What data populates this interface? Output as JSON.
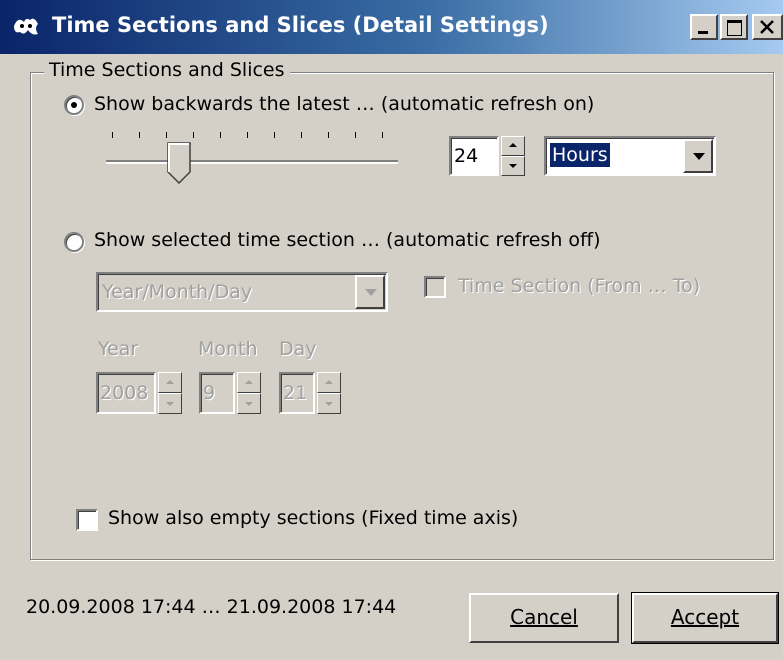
{
  "window": {
    "title": "Time Sections and Slices (Detail Settings)",
    "controls": {
      "minimize": "_",
      "maximize": "□",
      "close": "X"
    }
  },
  "group": {
    "label": "Time Sections and Slices"
  },
  "latest": {
    "radio_label": "Show backwards the latest … (automatic refresh on)",
    "selected": true,
    "slider_position": 0.25,
    "amount": "24",
    "unit": "Hours"
  },
  "section": {
    "radio_label": "Show selected time section … (automatic refresh off)",
    "selected": false,
    "mode_value": "Year/Month/Day",
    "time_section_label": "Time Section (From … To)",
    "year_label": "Year",
    "month_label": "Month",
    "day_label": "Day",
    "year": "2008",
    "month": "9",
    "day": "21"
  },
  "empty_sections": {
    "label": "Show also empty sections (Fixed time axis)",
    "checked": false
  },
  "footer": {
    "range_text": "20.09.2008 17:44 … 21.09.2008 17:44",
    "cancel_label": "Cancel",
    "accept_label": "Accept"
  }
}
